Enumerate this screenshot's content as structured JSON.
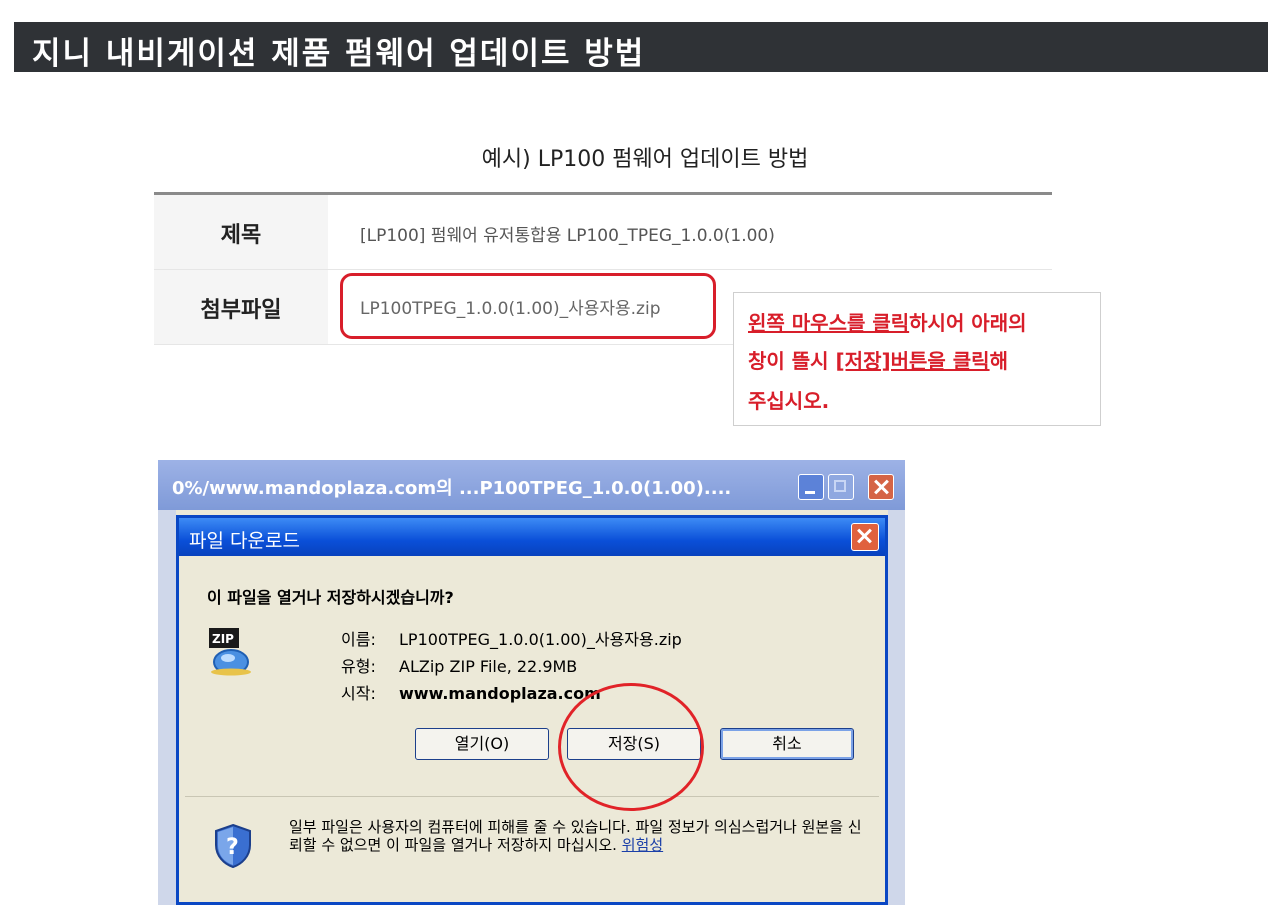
{
  "page_title": "지니 내비게이션 제품 펌웨어 업데이트 방법",
  "example_caption": "예시) LP100 펌웨어 업데이트 방법",
  "table": {
    "subject_label": "제목",
    "subject_value": "[LP100] 펌웨어 유저통합용 LP100_TPEG_1.0.0(1.00)",
    "attachment_label": "첨부파일",
    "attachment_file": "LP100TPEG_1.0.0(1.00)_사용자용.zip"
  },
  "instruction": {
    "line1_a": "왼쪽 마우스를 클릭",
    "line1_b": "하시어 아래의",
    "line2_a": "창이 뜰시 ",
    "line2_b": "[저장]버튼을 클릭",
    "line2_c": "해",
    "line3": "주십시오."
  },
  "browser_window": {
    "title": "0%/www.mandoplaza.com의 ...P100TPEG_1.0.0(1.00)...."
  },
  "download_dialog": {
    "title": "파일 다운로드",
    "question": "이 파일을 열거나 저장하시겠습니까?",
    "name_label": "이름:",
    "name_value": "LP100TPEG_1.0.0(1.00)_사용자용.zip",
    "type_label": "유형:",
    "type_value": "ALZip ZIP File, 22.9MB",
    "from_label": "시작:",
    "from_value": "www.mandoplaza.com",
    "open_button": "열기(O)",
    "save_button": "저장(S)",
    "cancel_button": "취소",
    "warning": "일부 파일은 사용자의 컴퓨터에 피해를 줄 수 있습니다. 파일 정보가 의심스럽거나 원본을 신뢰할 수 없으면 이 파일을 열거나 저장하지 마십시오.",
    "risk_link": "위험성"
  },
  "icons": {
    "zip": "zip-file-icon",
    "shield": "security-shield-icon"
  },
  "colors": {
    "title_bar_bg": "#2f3236",
    "highlight_red": "#d81e2a",
    "dialog_blue": "#0a4fd8",
    "dialog_bg": "#ece9d8"
  }
}
